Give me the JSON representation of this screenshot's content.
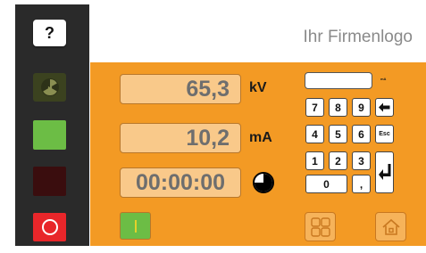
{
  "sidebar": {
    "help_label": "?"
  },
  "header": {
    "logo_text": "Ihr Firmenlogo"
  },
  "readouts": {
    "voltage": {
      "value": "65,3",
      "unit": "kV"
    },
    "current": {
      "value": "10,2",
      "unit": "mA"
    },
    "timer": {
      "value": "00:00:00"
    }
  },
  "keypad": {
    "display_value": "",
    "display_unit": "mA",
    "keys": [
      "7",
      "8",
      "9",
      "4",
      "5",
      "6",
      "1",
      "2",
      "3",
      "0",
      ","
    ],
    "esc_label": "Esc"
  },
  "colors": {
    "panel_orange": "#f39a24",
    "ready_green": "#6cbd45",
    "alarm_red": "#e8262a"
  }
}
